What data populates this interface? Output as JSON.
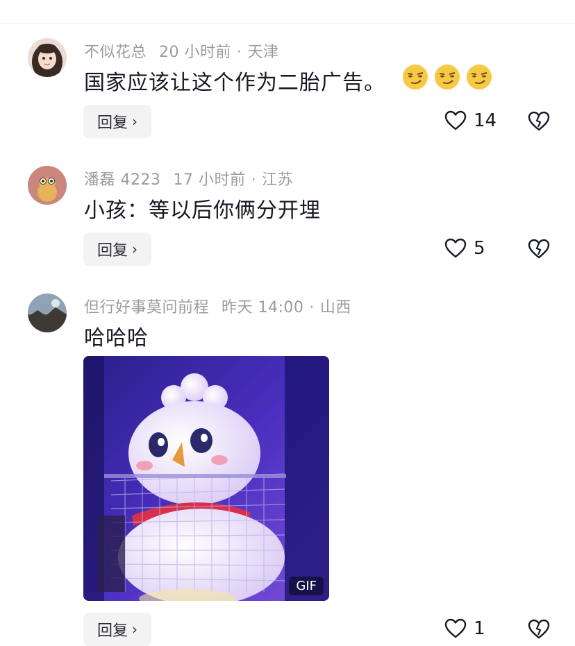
{
  "comments": [
    {
      "username": "不似花总",
      "time": "20 小时前",
      "separator": "·",
      "location": "天津",
      "text": "国家应该让这个作为二胎广告。",
      "emoji_icons": [
        "smirking-face-emoji",
        "smirking-face-emoji",
        "smirking-face-emoji"
      ],
      "reply_label": "回复",
      "likes": "14"
    },
    {
      "username": "潘磊 4223",
      "time": "17 小时前",
      "separator": "·",
      "location": "江苏",
      "text": "小孩：等以后你俩分开埋",
      "reply_label": "回复",
      "likes": "5"
    },
    {
      "username": "但行好事莫问前程",
      "time": "昨天 14:00",
      "separator": "·",
      "location": "山西",
      "text": "哈哈哈",
      "gif_badge": "GIF",
      "reply_label": "回复",
      "likes": "1"
    }
  ],
  "icons": {
    "like": "heart-outline-icon",
    "dislike": "broken-heart-icon",
    "reply_chevron": "chevron-right-icon"
  },
  "colors": {
    "text_primary": "#161823",
    "text_meta": "#9a9ba0",
    "reply_bg": "#f3f3f4"
  }
}
